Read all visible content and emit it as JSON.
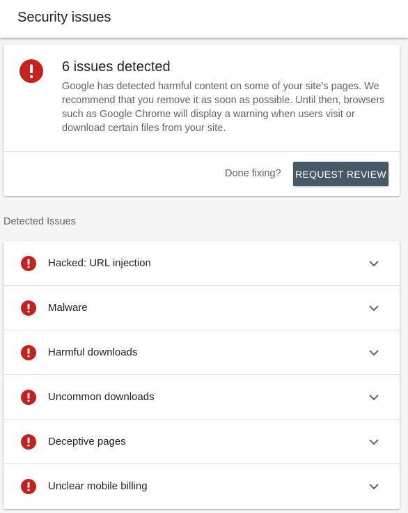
{
  "header": {
    "title": "Security issues"
  },
  "summary": {
    "title": "6 issues detected",
    "description": "Google has detected harmful content on some of your site’s pages. We recommend that you remove it as soon as possible. Until then, browsers such as Google Chrome will display a warning when users visit or download certain files from your site.",
    "done_label": "Done fixing?",
    "review_button": "REQUEST REVIEW"
  },
  "issues_section": {
    "label": "Detected Issues",
    "items": [
      {
        "label": "Hacked: URL injection"
      },
      {
        "label": "Malware"
      },
      {
        "label": "Harmful downloads"
      },
      {
        "label": "Uncommon downloads"
      },
      {
        "label": "Deceptive pages"
      },
      {
        "label": "Unclear mobile billing"
      }
    ]
  },
  "icons": {
    "alert": "alert-circle-icon",
    "expand": "chevron-down-icon"
  },
  "colors": {
    "alert_red": "#c5221f",
    "button_bg": "#455a64"
  }
}
